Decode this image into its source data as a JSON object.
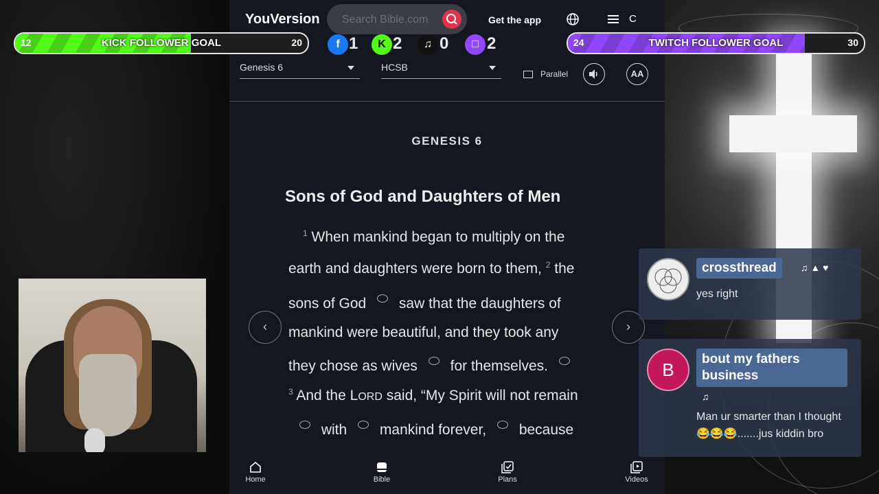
{
  "nav": {
    "logo": "YouVersion",
    "search_placeholder": "Search Bible.com",
    "get_app": "Get the app",
    "user_initial": "C"
  },
  "selectors": {
    "book": "Genesis 6",
    "version": "HCSB",
    "parallel": "Parallel",
    "font_size": "AA"
  },
  "reader": {
    "chapter_title": "GENESIS 6",
    "section_heading": "Sons of God and Daughters of Men",
    "lines": {
      "l1_num": "1",
      "l1": "When mankind began to multiply on the",
      "l2a": "earth and daughters were born to them,",
      "l2_num": "2",
      "l2b": "the",
      "l3a": "sons of God",
      "l3b": "saw that the daughters of",
      "l4": "mankind were beautiful, and they took any",
      "l5a": "they chose as wives",
      "l5b": "for themselves.",
      "l6_num": "3",
      "l6a": "And the",
      "l6_lord_l": "L",
      "l6_lord_rest": "ORD",
      "l6b": "said, “My Spirit will not remain",
      "l7a": "with",
      "l7b": "mankind forever,",
      "l7c": "because"
    }
  },
  "bottom_nav": {
    "home": "Home",
    "bible": "Bible",
    "plans": "Plans",
    "videos": "Videos"
  },
  "goals": {
    "kick": {
      "current": "12",
      "label": "KICK FOLLOWER GOAL",
      "target": "20",
      "progress": 0.6,
      "color": "#53fc18"
    },
    "twitch": {
      "current": "24",
      "label": "TWITCH FOLLOWER GOAL",
      "target": "30",
      "progress": 0.8,
      "color": "#9146ff"
    }
  },
  "socials": {
    "facebook": "1",
    "kick": "2",
    "tiktok": "0",
    "twitch": "2"
  },
  "chat": [
    {
      "user": "crossthread",
      "message": "yes right"
    },
    {
      "user_line1": "bout my fathers",
      "user_line2": "business",
      "avatar_letter": "B",
      "message_line1": "Man ur smarter than I thought",
      "message_line2": "😂😂😂.......jus kiddin bro"
    }
  ]
}
